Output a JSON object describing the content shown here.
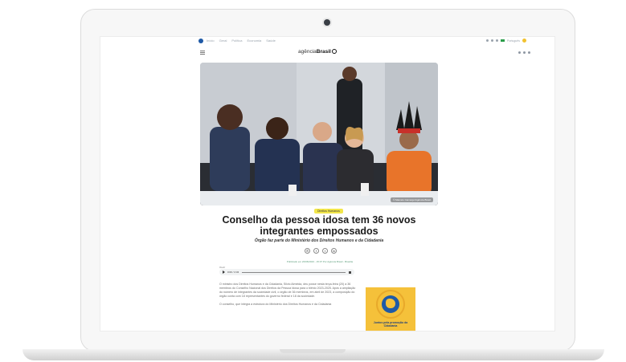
{
  "site": {
    "brand_prefix": "agência",
    "brand_name": "Brasil",
    "top_links": [
      "Início",
      "Geral",
      "Política",
      "Economia",
      "Saúde"
    ],
    "language": "Português"
  },
  "article": {
    "category": "Direitos Humanos",
    "title": "Conselho da pessoa idosa tem 36 novos integrantes empossados",
    "subtitle": "Órgão faz parte do Ministério dos Direitos Humanos e da Cidadania",
    "photo_credit": "© Marcelo Camargo/Agência Brasil",
    "meta": "Publicado em 20/06/2023 - 15:37 Por Agência Brasil - Brasília",
    "audio_label": "Ouvir",
    "audio_time": "0:00 / 2:34",
    "paragraphs": [
      "O ministro dos Direitos Humanos e da Cidadania, Silvio Almeida, deu posse nesta terça-feira (20) a 36 membros do Conselho Nacional dos Direitos da Pessoa Idosa para o biênio 2023-2025. Após a ampliação do número de integrantes da sociedade civil, o órgão de 36 membros, em abril de 2023, a composição do órgão conta com 18 representantes do governo federal e 18 da sociedade.",
      "O conselho, que integra a estrutura do Ministério dos Direitos Humanos e da Cidadania"
    ]
  },
  "ad": {
    "text": "Juntos pela promoção da Cidadania"
  },
  "colors": {
    "category_bg": "#f2e64a",
    "ad_bg": "#f5c13a",
    "brand_blue": "#1f5aa6"
  }
}
